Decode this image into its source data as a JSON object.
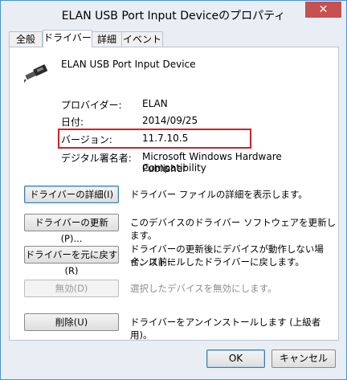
{
  "window": {
    "title": "ELAN USB Port Input Deviceのプロパティ",
    "close_label": "✕"
  },
  "tabs": [
    {
      "label": "全般"
    },
    {
      "label": "ドライバー"
    },
    {
      "label": "詳細"
    },
    {
      "label": "イベント"
    }
  ],
  "device": {
    "icon": "usb-connector-icon",
    "name": "ELAN USB Port Input Device"
  },
  "info": {
    "provider_label": "プロバイダー:",
    "provider_value": "ELAN",
    "date_label": "日付:",
    "date_value": "2014/09/25",
    "version_label": "バージョン:",
    "version_value": "11.7.10.5",
    "signer_label": "デジタル署名者:",
    "signer_value_line1": "Microsoft Windows Hardware Compatibility",
    "signer_value_line2": "Publisher"
  },
  "actions": [
    {
      "button": "ドライバーの詳細(I)",
      "description": "ドライバー ファイルの詳細を表示します。"
    },
    {
      "button": "ドライバーの更新(P)...",
      "description": "このデバイスのドライバー ソフトウェアを更新します。"
    },
    {
      "button": "ドライバーを元に戻す(R)",
      "description_line1": "ドライバーの更新後にデバイスが動作しない場合、以前に",
      "description_line2": "インストールしたドライバーに戻します。"
    },
    {
      "button": "無効(D)",
      "description": "選択したデバイスを無効にします。"
    },
    {
      "button": "削除(U)",
      "description": "ドライバーをアンインストールします (上級者用)。"
    }
  ],
  "footer": {
    "ok_label": "OK",
    "cancel_label": "キャンセル"
  },
  "colors": {
    "highlight_border": "#d0202a",
    "close_button": "#c75050"
  }
}
